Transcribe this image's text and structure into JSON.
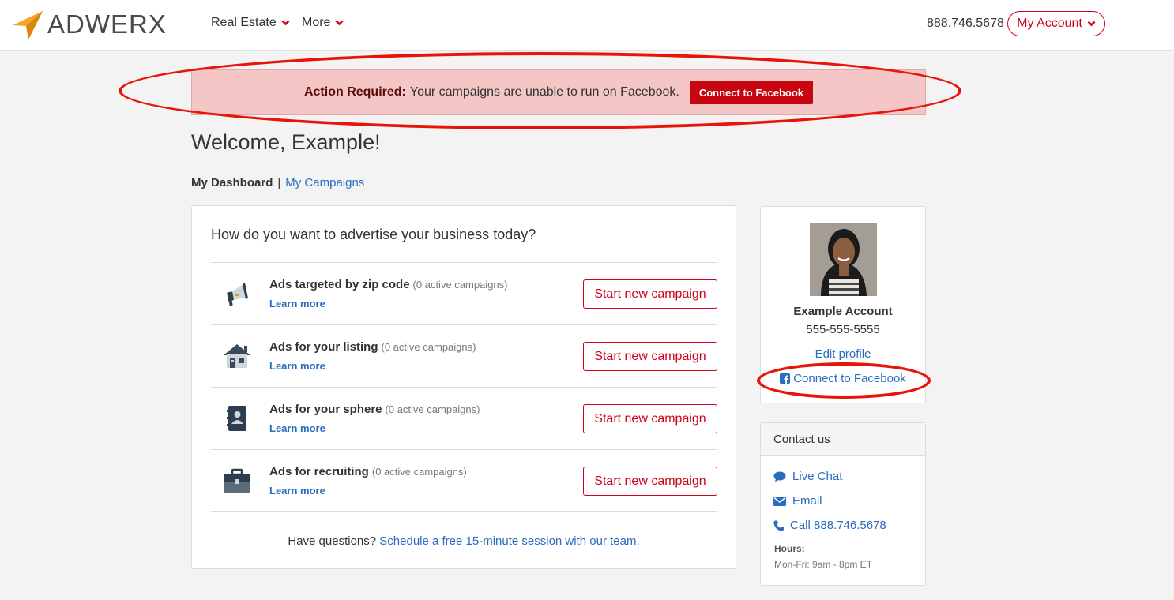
{
  "header": {
    "brand": "ADWERX",
    "nav": [
      {
        "label": "Real Estate"
      },
      {
        "label": "More"
      }
    ],
    "phone": "888.746.5678",
    "account_label": "My Account"
  },
  "alert": {
    "strong": "Action Required:",
    "message": "Your campaigns are unable to run on Facebook.",
    "button": "Connect to Facebook"
  },
  "welcome": "Welcome, Example!",
  "subnav": {
    "current": "My Dashboard",
    "separator": "|",
    "link": "My Campaigns"
  },
  "main": {
    "question": "How do you want to advertise your business today?",
    "rows": [
      {
        "title": "Ads targeted by zip code",
        "count": "(0 active campaigns)",
        "learn": "Learn more",
        "button": "Start new campaign",
        "icon": "megaphone-icon"
      },
      {
        "title": "Ads for your listing",
        "count": "(0 active campaigns)",
        "learn": "Learn more",
        "button": "Start new campaign",
        "icon": "house-icon"
      },
      {
        "title": "Ads for your sphere",
        "count": "(0 active campaigns)",
        "learn": "Learn more",
        "button": "Start new campaign",
        "icon": "address-book-icon"
      },
      {
        "title": "Ads for recruiting",
        "count": "(0 active campaigns)",
        "learn": "Learn more",
        "button": "Start new campaign",
        "icon": "briefcase-icon"
      }
    ],
    "questions_prefix": "Have questions?",
    "questions_link": "Schedule a free 15-minute session with our team."
  },
  "profile": {
    "name": "Example Account",
    "phone": "555-555-5555",
    "edit": "Edit profile",
    "facebook": "Connect to Facebook"
  },
  "contact": {
    "title": "Contact us",
    "live_chat": "Live Chat",
    "email": "Email",
    "call": "Call 888.746.5678",
    "hours_label": "Hours:",
    "hours": "Mon-Fri: 9am - 8pm ET"
  },
  "colors": {
    "accent": "#d0021b",
    "link": "#2a6cbf",
    "alert_bg": "#f5c6c6",
    "annotation": "#e8140a"
  }
}
